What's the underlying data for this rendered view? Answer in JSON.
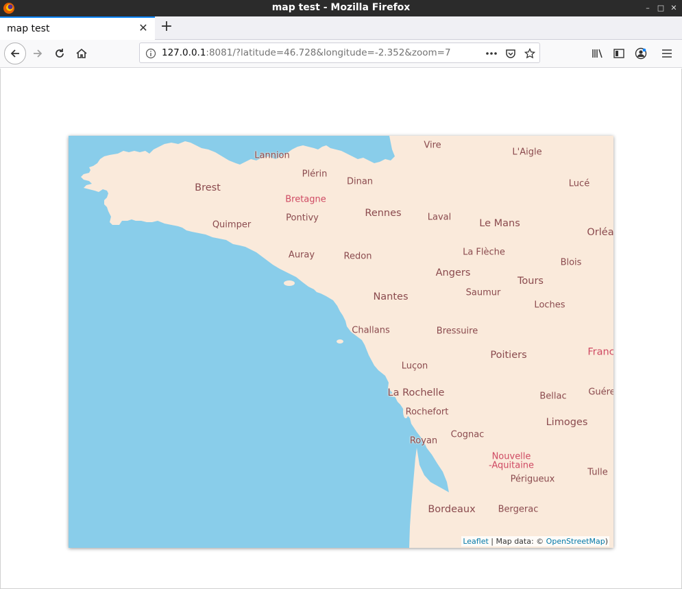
{
  "window": {
    "title": "map test - Mozilla Firefox"
  },
  "tabs": [
    {
      "label": "map test"
    }
  ],
  "urlbar": {
    "host": "127.0.0.1",
    "rest": ":8081/?latitude=46.728&longitude=-2.352&zoom=7"
  },
  "map": {
    "colors": {
      "water": "#89cdea",
      "land": "#faeadb",
      "city_label": "#8a4a4e",
      "region_label": "#cf4a63"
    },
    "places": [
      {
        "id": "vire",
        "name": "Vire"
      },
      {
        "id": "laigle",
        "name": "L'Aigle"
      },
      {
        "id": "lannion",
        "name": "Lannion"
      },
      {
        "id": "plerin",
        "name": "Plérin"
      },
      {
        "id": "dinan",
        "name": "Dinan"
      },
      {
        "id": "luce",
        "name": "Lucé"
      },
      {
        "id": "brest",
        "name": "Brest"
      },
      {
        "id": "bretagne",
        "name": "Bretagne"
      },
      {
        "id": "rennes",
        "name": "Rennes"
      },
      {
        "id": "quimper",
        "name": "Quimper"
      },
      {
        "id": "pontivy",
        "name": "Pontivy"
      },
      {
        "id": "laval",
        "name": "Laval"
      },
      {
        "id": "lemans",
        "name": "Le Mans"
      },
      {
        "id": "orleans",
        "name": "Orléa"
      },
      {
        "id": "auray",
        "name": "Auray"
      },
      {
        "id": "redon",
        "name": "Redon"
      },
      {
        "id": "lafleche",
        "name": "La Flèche"
      },
      {
        "id": "blois",
        "name": "Blois"
      },
      {
        "id": "angers",
        "name": "Angers"
      },
      {
        "id": "tours",
        "name": "Tours"
      },
      {
        "id": "saumur",
        "name": "Saumur"
      },
      {
        "id": "nantes",
        "name": "Nantes"
      },
      {
        "id": "loches",
        "name": "Loches"
      },
      {
        "id": "challans",
        "name": "Challans"
      },
      {
        "id": "bressuire",
        "name": "Bressuire"
      },
      {
        "id": "poitiers",
        "name": "Poitiers"
      },
      {
        "id": "france",
        "name": "Franc"
      },
      {
        "id": "lucon",
        "name": "Luçon"
      },
      {
        "id": "larochelle",
        "name": "La Rochelle"
      },
      {
        "id": "bellac",
        "name": "Bellac"
      },
      {
        "id": "guere",
        "name": "Guére"
      },
      {
        "id": "rochefort",
        "name": "Rochefort"
      },
      {
        "id": "limoges",
        "name": "Limoges"
      },
      {
        "id": "cognac",
        "name": "Cognac"
      },
      {
        "id": "royan",
        "name": "Royan"
      },
      {
        "id": "nouvelle",
        "name": "Nouvelle"
      },
      {
        "id": "aquitaine",
        "name": "-Aquitaine"
      },
      {
        "id": "tulle",
        "name": "Tulle"
      },
      {
        "id": "perigueux",
        "name": "Périgueux"
      },
      {
        "id": "bordeaux",
        "name": "Bordeaux"
      },
      {
        "id": "bergerac",
        "name": "Bergerac"
      }
    ],
    "attribution": {
      "leaflet": "Leaflet",
      "separator": " | Map data: © ",
      "osm": "OpenStreetMap",
      "close_paren": ")"
    }
  }
}
